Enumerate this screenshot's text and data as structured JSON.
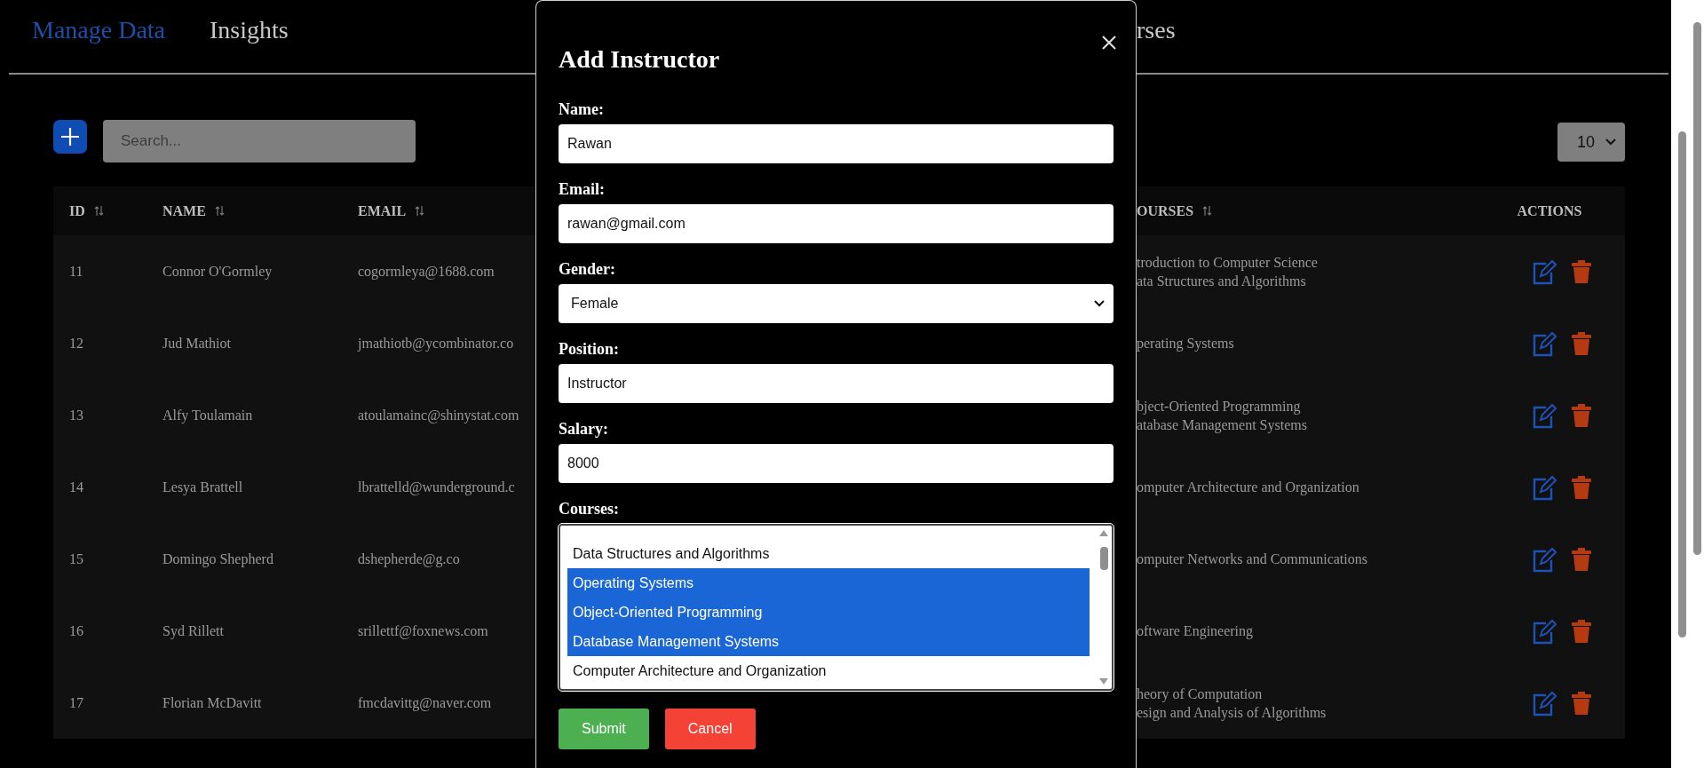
{
  "nav_tabs": [
    {
      "label": "Manage Data",
      "selected": true
    },
    {
      "label": "Insights",
      "selected": false
    },
    {
      "label": "rses",
      "selected": false
    }
  ],
  "toolbar": {
    "search_placeholder": "Search...",
    "page_size": "10"
  },
  "table": {
    "left_columns": [
      {
        "label": "ID",
        "sortable": true
      },
      {
        "label": "NAME",
        "sortable": true
      },
      {
        "label": "EMAIL",
        "sortable": true
      }
    ],
    "right_columns": [
      {
        "label": "OURSES",
        "sortable": true
      },
      {
        "label": "ACTIONS",
        "sortable": false
      }
    ],
    "rows": [
      {
        "id": "11",
        "name": "Connor O'Gormley",
        "email": "cogormleya@1688.com",
        "courses": [
          "troduction to Computer Science",
          "ata Structures and Algorithms"
        ]
      },
      {
        "id": "12",
        "name": "Jud Mathiot",
        "email": "jmathiotb@ycombinator.co",
        "courses": [
          "perating Systems"
        ]
      },
      {
        "id": "13",
        "name": "Alfy Toulamain",
        "email": "atoulamainc@shinystat.com",
        "courses": [
          "bject-Oriented Programming",
          "atabase Management Systems"
        ]
      },
      {
        "id": "14",
        "name": "Lesya Brattell",
        "email": "lbrattelld@wunderground.c",
        "courses": [
          "omputer Architecture and Organization"
        ]
      },
      {
        "id": "15",
        "name": "Domingo Shepherd",
        "email": "dshepherde@g.co",
        "courses": [
          "omputer Networks and Communications"
        ]
      },
      {
        "id": "16",
        "name": "Syd Rillett",
        "email": "srillettf@foxnews.com",
        "courses": [
          "oftware Engineering"
        ]
      },
      {
        "id": "17",
        "name": "Florian McDavitt",
        "email": "fmcdavittg@naver.com",
        "courses": [
          "heory of Computation",
          "esign and Analysis of Algorithms"
        ]
      }
    ]
  },
  "modal": {
    "title": "Add Instructor",
    "fields": [
      {
        "kind": "text",
        "label": "Name:",
        "value": "Rawan"
      },
      {
        "kind": "text",
        "label": "Email:",
        "value": "rawan@gmail.com"
      },
      {
        "kind": "select",
        "label": "Gender:",
        "value": "Female"
      },
      {
        "kind": "text",
        "label": "Position:",
        "value": "Instructor"
      },
      {
        "kind": "text",
        "label": "Salary:",
        "value": "8000"
      },
      {
        "kind": "listbox",
        "label": "Courses:",
        "options": [
          {
            "label": "Data Structures and Algorithms",
            "selected": false
          },
          {
            "label": "Operating Systems",
            "selected": true
          },
          {
            "label": "Object-Oriented Programming",
            "selected": true
          },
          {
            "label": "Database Management Systems",
            "selected": true
          },
          {
            "label": "Computer Architecture and Organization",
            "selected": false
          }
        ]
      }
    ],
    "buttons": [
      {
        "kind": "submit",
        "label": "Submit"
      },
      {
        "kind": "cancel",
        "label": "Cancel"
      }
    ]
  }
}
